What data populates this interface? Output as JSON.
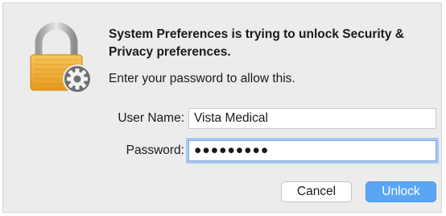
{
  "dialog": {
    "title": "System Preferences is trying to unlock Security & Privacy preferences.",
    "message": "Enter your password to allow this.",
    "icon": "padlock-with-gear-icon"
  },
  "form": {
    "username_label": "User Name:",
    "username_value": "Vista Medical",
    "password_label": "Password:",
    "password_value": "●●●●●●●●●"
  },
  "buttons": {
    "cancel_label": "Cancel",
    "unlock_label": "Unlock"
  },
  "colors": {
    "accent": "#5aa6f5",
    "dialog_background": "#ececec",
    "focus_ring": "#a9c7f0"
  }
}
